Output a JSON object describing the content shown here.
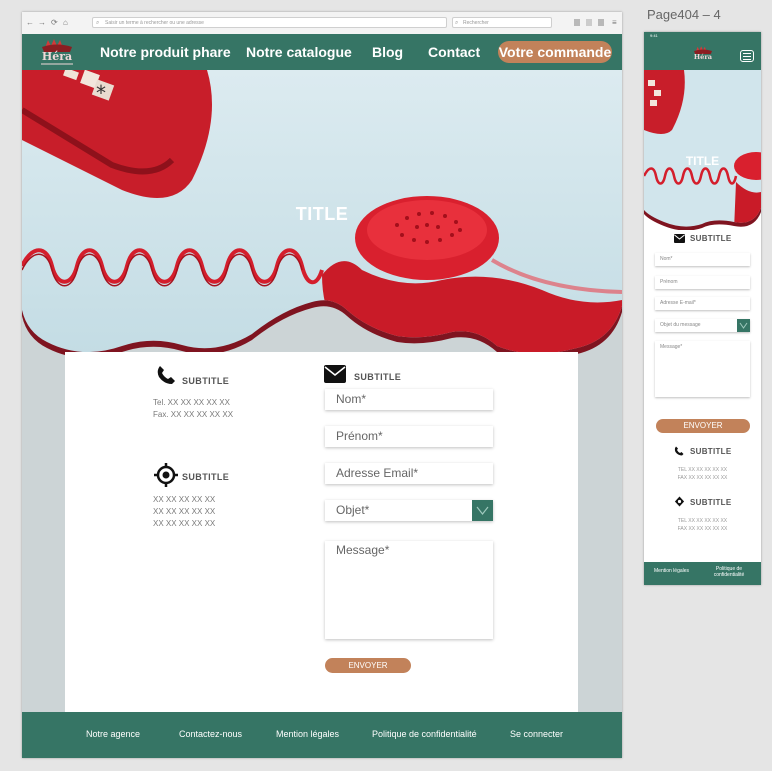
{
  "browser": {
    "url_placeholder": "Saisir un terme à rechercher ou une adresse",
    "search_placeholder": "Rechercher"
  },
  "logo": {
    "text": "Héra",
    "tagline": "cosmétiques"
  },
  "nav": {
    "items": [
      "Notre produit phare",
      "Notre catalogue",
      "Blog",
      "Contact"
    ],
    "order_button": "Votre commande"
  },
  "hero": {
    "title": "TITLE"
  },
  "contact": {
    "phone_subtitle": "SUBTITLE",
    "tel": "Tel. XX XX XX XX XX",
    "fax": "Fax. XX XX XX XX XX",
    "address_subtitle": "SUBTITLE",
    "address_lines": [
      "XX XX XX XX XX",
      "XX XX XX XX XX",
      "XX XX XX XX XX"
    ]
  },
  "form": {
    "subtitle": "SUBTITLE",
    "name_placeholder": "Nom*",
    "firstname_placeholder": "Prénom*",
    "email_placeholder": "Adresse Email*",
    "subject_placeholder": "Objet*",
    "message_placeholder": "Message*",
    "send_button": "ENVOYER"
  },
  "footer": {
    "links": [
      "Notre agence",
      "Contactez-nous",
      "Mention légales",
      "Politique de confidentialité",
      "Se connecter"
    ]
  },
  "mobile": {
    "artboard_label": "Page404 – 4",
    "status_time": "9:41",
    "title": "TITLE",
    "form_subtitle": "SUBTITLE",
    "name_placeholder": "Nom*",
    "firstname_placeholder": "Prénom",
    "email_placeholder": "Adresse E-mail*",
    "subject_placeholder": "Objet du message",
    "message_placeholder": "Message*",
    "send_button": "ENVOYER",
    "phone_subtitle": "SUBTITLE",
    "tel": "TEL XX XX XX XX XX",
    "fax": "FAX XX XX XX XX XX",
    "address_subtitle": "SUBTITLE",
    "address_tel": "TEL XX XX XX XX XX",
    "address_fax": "FAX XX XX XX XX XX",
    "footer_links": [
      "Mention légales",
      "Politique de confidentialité"
    ]
  },
  "colors": {
    "brand_green": "#367565",
    "accent_copper": "#c2825a",
    "phone_red": "#d41e2c",
    "sky": "#cfe3ea"
  }
}
